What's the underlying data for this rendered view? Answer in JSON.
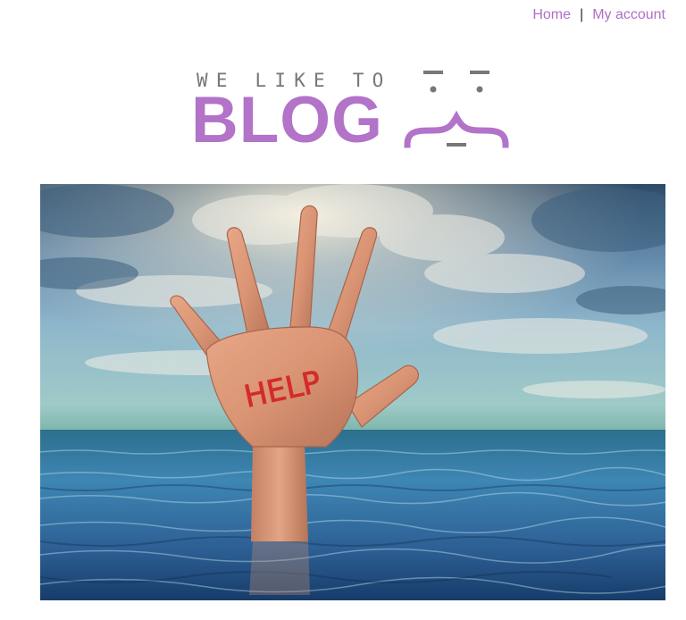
{
  "nav": {
    "home_label": "Home",
    "separator": "|",
    "account_label": "My account"
  },
  "logo": {
    "tagline": "WE LIKE TO",
    "wordmark": "BLOG",
    "wordmark_color": "#b273c9",
    "tagline_color": "#777777"
  },
  "hero": {
    "palm_text": "HELP",
    "palm_text_color": "#d42a2a"
  },
  "colors": {
    "link": "#b06fc5",
    "accent": "#b273c9"
  }
}
